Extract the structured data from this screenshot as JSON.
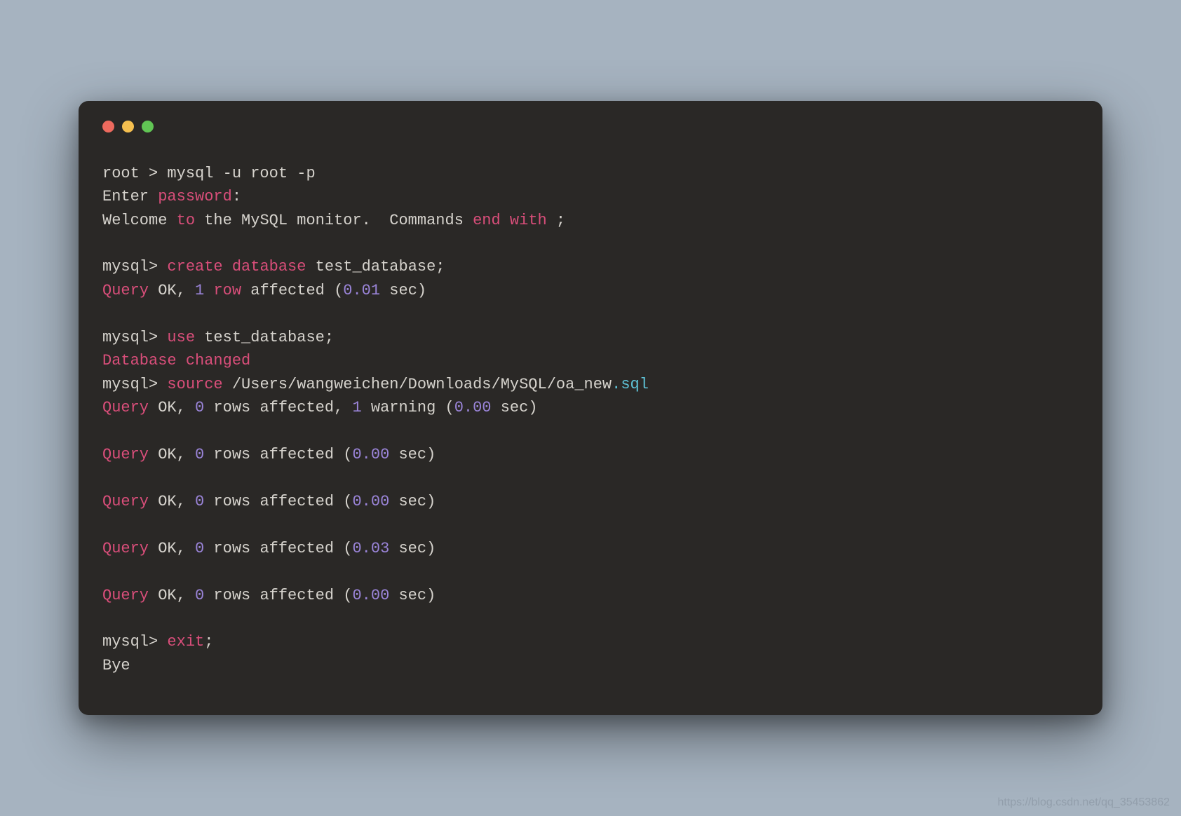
{
  "colors": {
    "background": "#a6b3c0",
    "terminal_bg": "#2a2826",
    "plain": "#d6d3cd",
    "keyword": "#d94e7a",
    "number": "#9a84d8",
    "func": "#5ec2d6",
    "traffic_red": "#ed6a5e",
    "traffic_yellow": "#f5bf4f",
    "traffic_green": "#61c554"
  },
  "watermark": "https://blog.csdn.net/qq_35453862",
  "lines": {
    "l1a": "root > mysql -u root -p",
    "l2a": "Enter ",
    "l2b": "password",
    "l2c": ":",
    "l3a": "Welcome ",
    "l3b": "to",
    "l3c": " the MySQL monitor.  Commands ",
    "l3d": "end",
    "l3e": " ",
    "l3f": "with",
    "l3g": " ;",
    "l5a": "mysql> ",
    "l5b": "create",
    "l5c": " ",
    "l5d": "database",
    "l5e": " test_database;",
    "l6a": "Query",
    "l6b": " OK, ",
    "l6c": "1",
    "l6d": " ",
    "l6e": "row",
    "l6f": " affected (",
    "l6g": "0.01",
    "l6h": " sec)",
    "l8a": "mysql> ",
    "l8b": "use",
    "l8c": " test_database;",
    "l9a": "Database",
    "l9b": " ",
    "l9c": "changed",
    "l10a": "mysql> ",
    "l10b": "source",
    "l10c": " /Users/wangweichen/Downloads/MySQL/oa_new",
    "l10d": ".sql",
    "l11a": "Query",
    "l11b": " OK, ",
    "l11c": "0",
    "l11d": " rows affected, ",
    "l11e": "1",
    "l11f": " warning (",
    "l11g": "0.00",
    "l11h": " sec)",
    "l13a": "Query",
    "l13b": " OK, ",
    "l13c": "0",
    "l13d": " rows affected (",
    "l13e": "0.00",
    "l13f": " sec)",
    "l15a": "Query",
    "l15b": " OK, ",
    "l15c": "0",
    "l15d": " rows affected (",
    "l15e": "0.00",
    "l15f": " sec)",
    "l17a": "Query",
    "l17b": " OK, ",
    "l17c": "0",
    "l17d": " rows affected (",
    "l17e": "0.03",
    "l17f": " sec)",
    "l19a": "Query",
    "l19b": " OK, ",
    "l19c": "0",
    "l19d": " rows affected (",
    "l19e": "0.00",
    "l19f": " sec)",
    "l21a": "mysql> ",
    "l21b": "exit",
    "l21c": ";",
    "l22a": "Bye"
  }
}
